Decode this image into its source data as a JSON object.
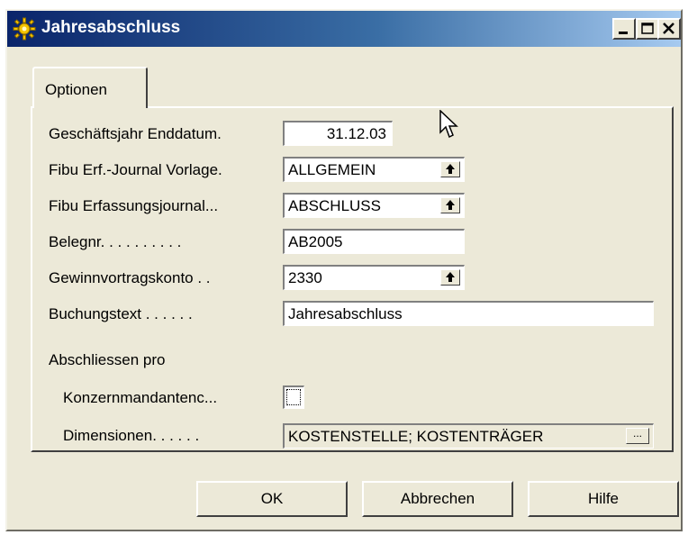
{
  "window": {
    "title": "Jahresabschluss",
    "controls": {
      "minimize": "_",
      "maximize": "□",
      "close": "X"
    }
  },
  "tabs": [
    {
      "label": "Optionen",
      "active": true
    }
  ],
  "form": {
    "fiscal_year_end_label": "Geschäftsjahr Enddatum.",
    "fiscal_year_end_value": "31.12.03",
    "gl_template_label": "Fibu Erf.-Journal Vorlage.",
    "gl_template_value": "ALLGEMEIN",
    "gl_batch_label": "Fibu Erfassungsjournal...",
    "gl_batch_value": "ABSCHLUSS",
    "document_no_label": "Belegnr. . . . . . . . . .",
    "document_no_value": "AB2005",
    "retained_earnings_label": "Gewinnvortragskonto . .",
    "retained_earnings_value": "2330",
    "posting_description_label": "Buchungstext . . . . . .",
    "posting_description_value": "Jahresabschluss",
    "close_per_label": "Abschliessen pro",
    "business_unit_label": "Konzernmandantenc...",
    "business_unit_checked": false,
    "dimensions_label": "Dimensionen. . . . . .",
    "dimensions_value": "KOSTENSTELLE; KOSTENTRÄGER",
    "assist_button": "..."
  },
  "buttons": {
    "ok": "OK",
    "cancel": "Abbrechen",
    "help": "Hilfe"
  },
  "icons": {
    "title": "sun-gear-icon",
    "lookup": "up-arrow-icon",
    "cursor": "mouse-pointer-icon"
  }
}
